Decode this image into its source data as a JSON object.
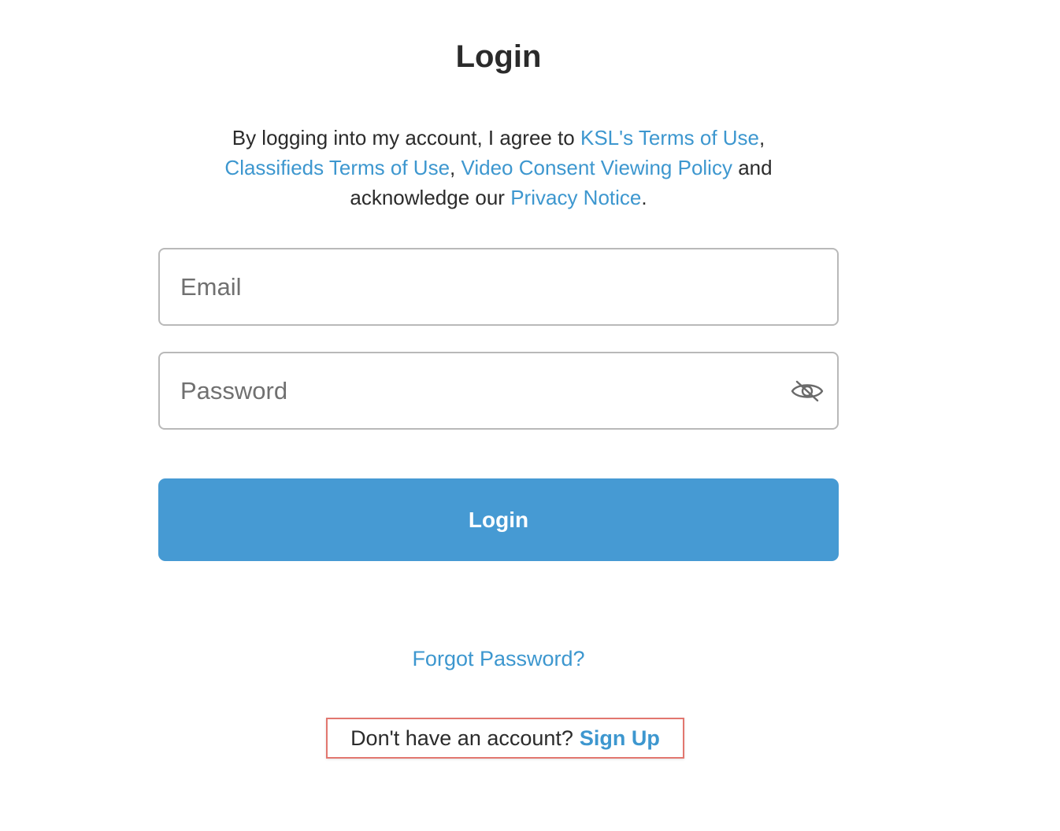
{
  "header": {
    "title": "Login"
  },
  "agreement": {
    "text_1": "By logging into my account, I agree to ",
    "link_ksl_terms": "KSL's Terms of Use",
    "sep_1": ",",
    "link_classifieds_terms": "Classifieds Terms of Use",
    "sep_2": ", ",
    "link_video_policy": "Video Consent Viewing Policy",
    "text_2": " and acknowledge our ",
    "link_privacy": "Privacy Notice",
    "text_3": "."
  },
  "form": {
    "email_placeholder": "Email",
    "email_value": "",
    "password_placeholder": "Password",
    "password_value": "",
    "password_toggle_icon": "eye-slash-icon",
    "login_label": "Login"
  },
  "footer": {
    "forgot_password": "Forgot Password?",
    "signup_prompt": "Don't have an account?",
    "signup_link": "Sign Up"
  },
  "colors": {
    "accent": "#469ad3",
    "link": "#3d97cf",
    "text": "#2b2b2b",
    "highlight_border": "#e2776f"
  }
}
